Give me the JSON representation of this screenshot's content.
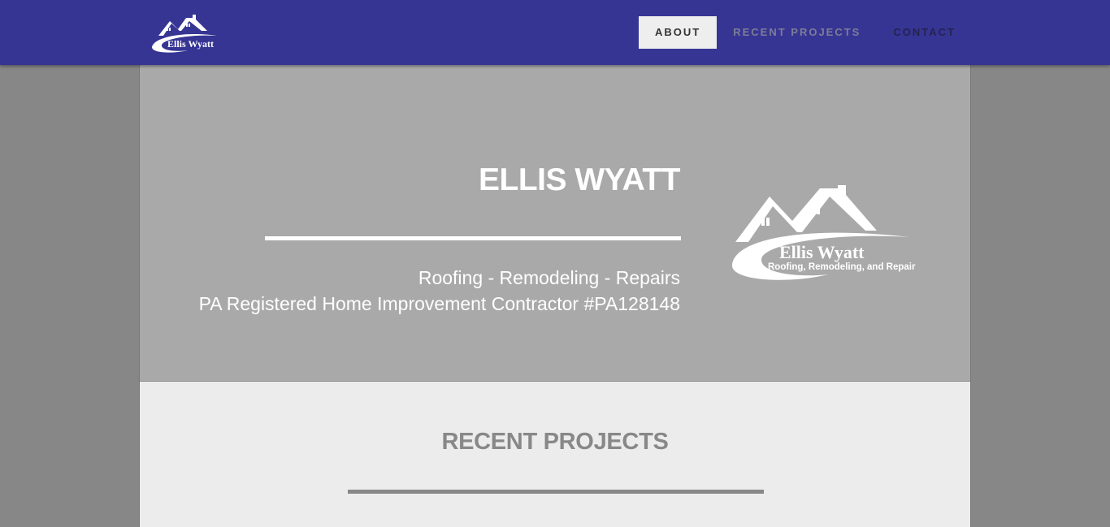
{
  "nav": {
    "brand_name": "Ellis Wyatt",
    "links": [
      {
        "label": "ABOUT",
        "active": true
      },
      {
        "label": "RECENT PROJECTS",
        "active": false
      },
      {
        "label": "CONTACT",
        "active": false
      }
    ]
  },
  "hero": {
    "title": "ELLIS WYATT",
    "tagline": "Roofing - Remodeling - Repairs",
    "registration": "PA Registered Home Improvement Contractor #PA128148",
    "logo": {
      "name": "Ellis Wyatt",
      "subtitle": "Roofing, Remodeling, and Repair"
    }
  },
  "projects": {
    "heading": "RECENT PROJECTS"
  },
  "colors": {
    "navbar": "#363594",
    "hero_bg": "#a9a9a9",
    "page_bg": "#878787",
    "section_bg": "#ececec",
    "active_tab_bg": "#eeeeee"
  }
}
